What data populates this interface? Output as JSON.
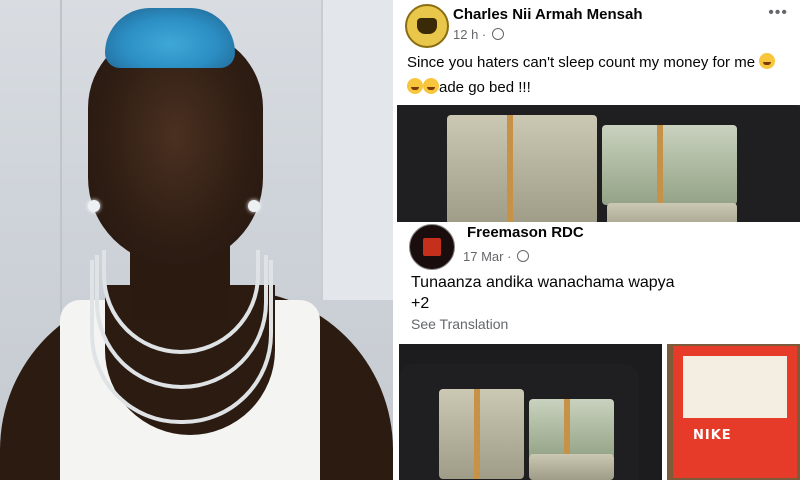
{
  "posts": [
    {
      "author": "Charles Nii Armah Mensah",
      "time": "12 h",
      "separator": " · ",
      "text_line1": "Since you haters  can't sleep count my money for me ",
      "text_line2": "ade go bed !!!",
      "more": "•••"
    },
    {
      "author": "Freemason RDC",
      "time": "17 Mar",
      "separator": " · ",
      "text_line1": "Tunaanza andika wanachama wapya",
      "text_line2": "+2",
      "see_translation": "See Translation",
      "box_brand": "NIKE"
    }
  ],
  "icons": {
    "globe": "globe-icon",
    "more": "more-options-icon",
    "emoji": "laughing-emoji-icon"
  },
  "colors": {
    "hair": "#3fa8d8",
    "shoe_box": "#e73b2a",
    "meta_text": "#65676b"
  }
}
